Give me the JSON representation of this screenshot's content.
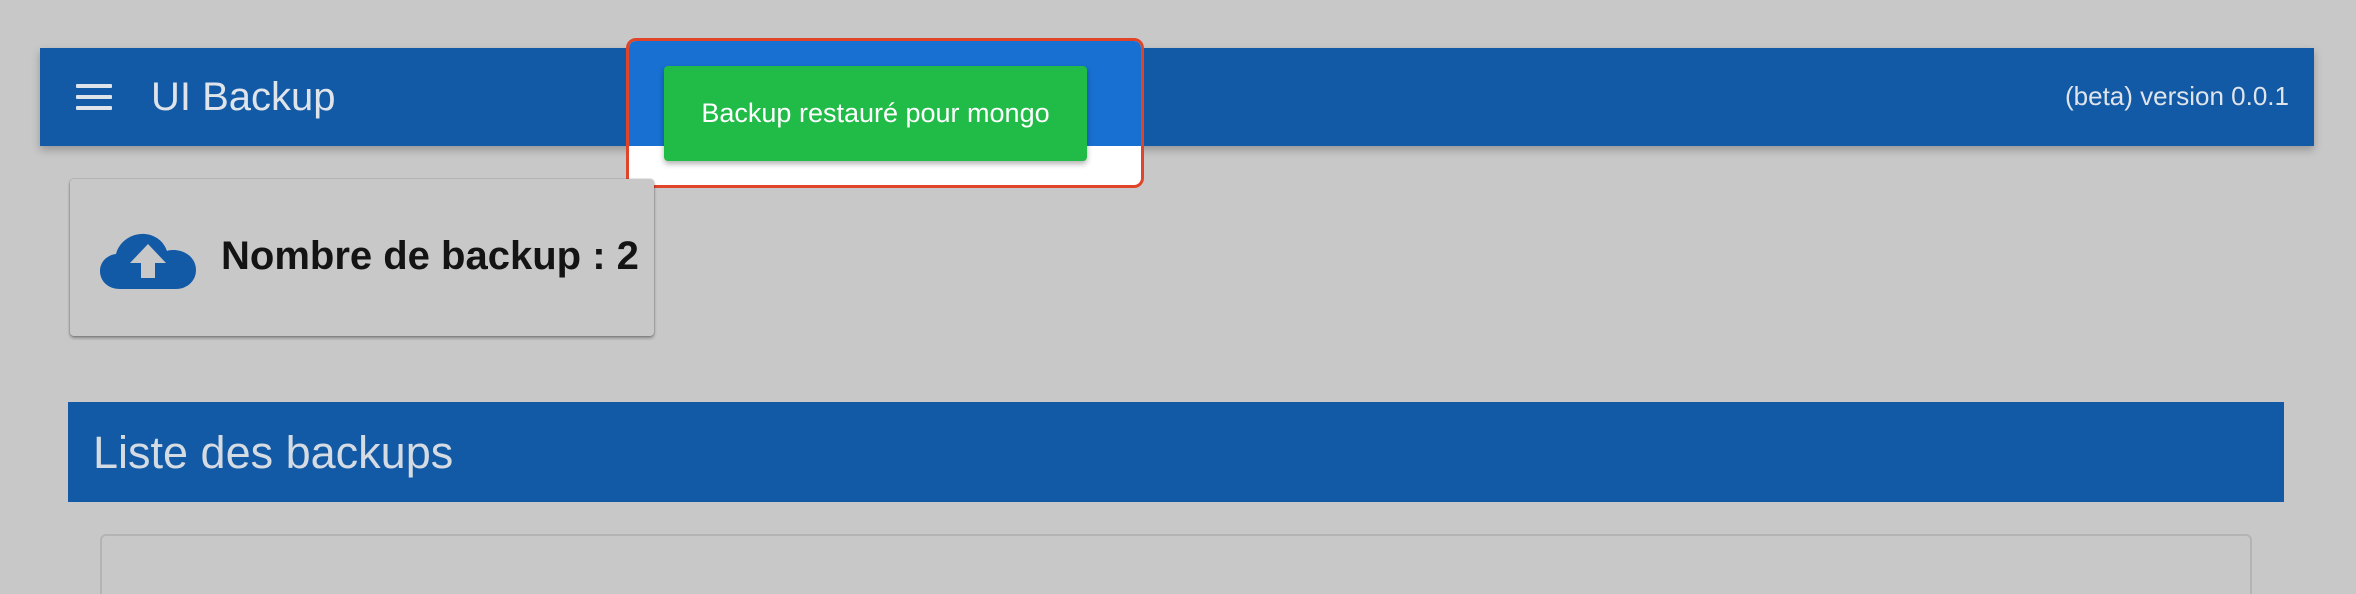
{
  "header": {
    "title": "UI Backup",
    "version": "(beta) version 0.0.1"
  },
  "toast": {
    "message": "Backup restauré pour mongo"
  },
  "stats_card": {
    "text": "Nombre de backup : 2"
  },
  "backups_section": {
    "title": "Liste des backups"
  },
  "icons": {
    "menu": "menu-icon",
    "backup": "cloud-upload-icon"
  },
  "colors": {
    "appbar": "#1259a6",
    "toast": "#21bb48",
    "highlight": "#e0452a",
    "background": "#c8c8c8"
  }
}
